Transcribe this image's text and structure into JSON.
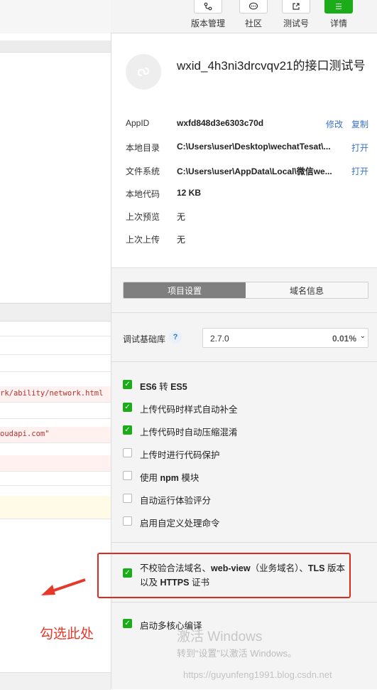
{
  "toolbar": {
    "buttons": [
      {
        "label": "版本管理",
        "icon": "branch-icon"
      },
      {
        "label": "社区",
        "icon": "chat-bubble-icon"
      },
      {
        "label": "测试号",
        "icon": "external-link-icon"
      },
      {
        "label": "详情",
        "icon": "menu-icon"
      }
    ]
  },
  "project": {
    "title": "wxid_4h3ni3drcvqv21的接口测试号",
    "fields": [
      {
        "key": "AppID",
        "value": "wxfd848d3e6303c70d",
        "actions": [
          "修改",
          "复制"
        ]
      },
      {
        "key": "本地目录",
        "value": "C:\\Users\\user\\Desktop\\wechatTesat\\...",
        "actions": [
          "打开"
        ]
      },
      {
        "key": "文件系统",
        "value": "C:\\Users\\user\\AppData\\Local\\微信we...",
        "actions": [
          "打开"
        ]
      },
      {
        "key": "本地代码",
        "value": "12 KB",
        "actions": []
      },
      {
        "key": "上次预览",
        "value": "无",
        "actions": []
      },
      {
        "key": "上次上传",
        "value": "无",
        "actions": []
      }
    ]
  },
  "tabs": [
    {
      "label": "项目设置",
      "active": true
    },
    {
      "label": "域名信息",
      "active": false
    }
  ],
  "library": {
    "label": "调试基础库",
    "help": "?",
    "version": "2.7.0",
    "percent": "0.01%",
    "chevron": "⌄"
  },
  "settings": [
    {
      "label": "ES6 转 ES5",
      "checked": true
    },
    {
      "label": "上传代码时样式自动补全",
      "checked": true
    },
    {
      "label": "上传代码时自动压缩混淆",
      "checked": true
    },
    {
      "label": "上传时进行代码保护",
      "checked": false
    },
    {
      "label": "使用 npm 模块",
      "checked": false
    },
    {
      "label": "自动运行体验评分",
      "checked": false
    },
    {
      "label": "启用自定义处理命令",
      "checked": false
    }
  ],
  "tls_option": {
    "label": "不校验合法域名、web-view（业务域名）、TLS 版本以及 HTTPS 证书",
    "checked": true
  },
  "multicore_option": {
    "label": "启动多核心编译",
    "checked": true
  },
  "left_console": {
    "lines": [
      "rk/ability/network.html",
      "oudapi.com\""
    ]
  },
  "annotation": {
    "text": "勾选此处",
    "color": "#e4392b"
  },
  "watermarks": {
    "windows_title": "激活 Windows",
    "windows_sub": "转到“设置”以激活 Windows。",
    "url": "https://guyunfeng1991.blog.csdn.net"
  },
  "colors": {
    "accent_green": "#1aad19",
    "link_blue": "#3b73c4",
    "highlight_red": "#e0291f"
  }
}
